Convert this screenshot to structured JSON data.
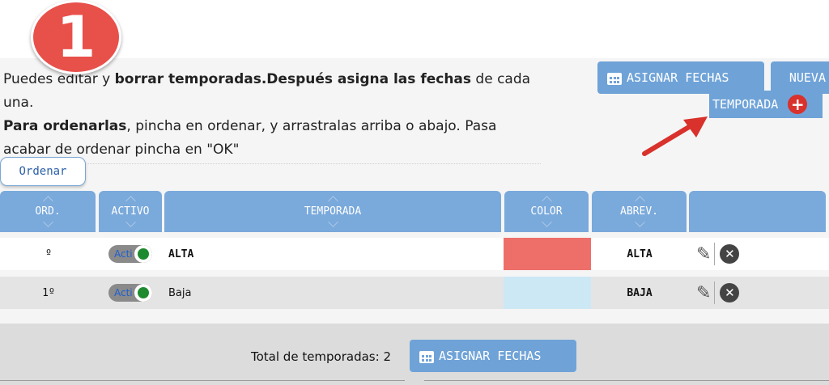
{
  "step": "1",
  "intro": {
    "part1": "Puedes ",
    "part2": "editar y ",
    "bold1": "borrar temporadas.Después asigna las fechas",
    "part3": " de cada una. ",
    "bold2": "Para ordenarlas",
    "part4": ", pincha en ordenar, y arrastralas arriba o abajo. Pasa acabar de ordenar pincha en \"OK\""
  },
  "toolbar": {
    "assign_label": "ASIGNAR FECHAS",
    "new_label_1": "NUEVA",
    "new_label_2": "TEMPORADA"
  },
  "ordenar_label": "Ordenar",
  "table": {
    "headers": [
      "ORD.",
      "ACTIVO",
      "TEMPORADA",
      "COLOR",
      "ABREV."
    ],
    "rows": [
      {
        "ord": "º",
        "activo": "Acti",
        "temporada": "ALTA",
        "color": "#ee6f6a",
        "abrev": "ALTA"
      },
      {
        "ord": "1º",
        "activo": "Acti",
        "temporada": "Baja",
        "color": "#cde8f5",
        "abrev": "BAJA"
      }
    ]
  },
  "footer": {
    "total_label": "Total de temporadas: 2",
    "assign_label": "ASIGNAR FECHAS"
  },
  "icons": {
    "calendar": "calendar-icon",
    "plus": "plus-circle-icon",
    "edit": "pencil-icon",
    "delete": "close-circle-icon",
    "arrow": "red-arrow-annotation"
  },
  "colors": {
    "accent": "#7aa9db",
    "badge": "#e8504a",
    "arrow": "#d9312b"
  }
}
